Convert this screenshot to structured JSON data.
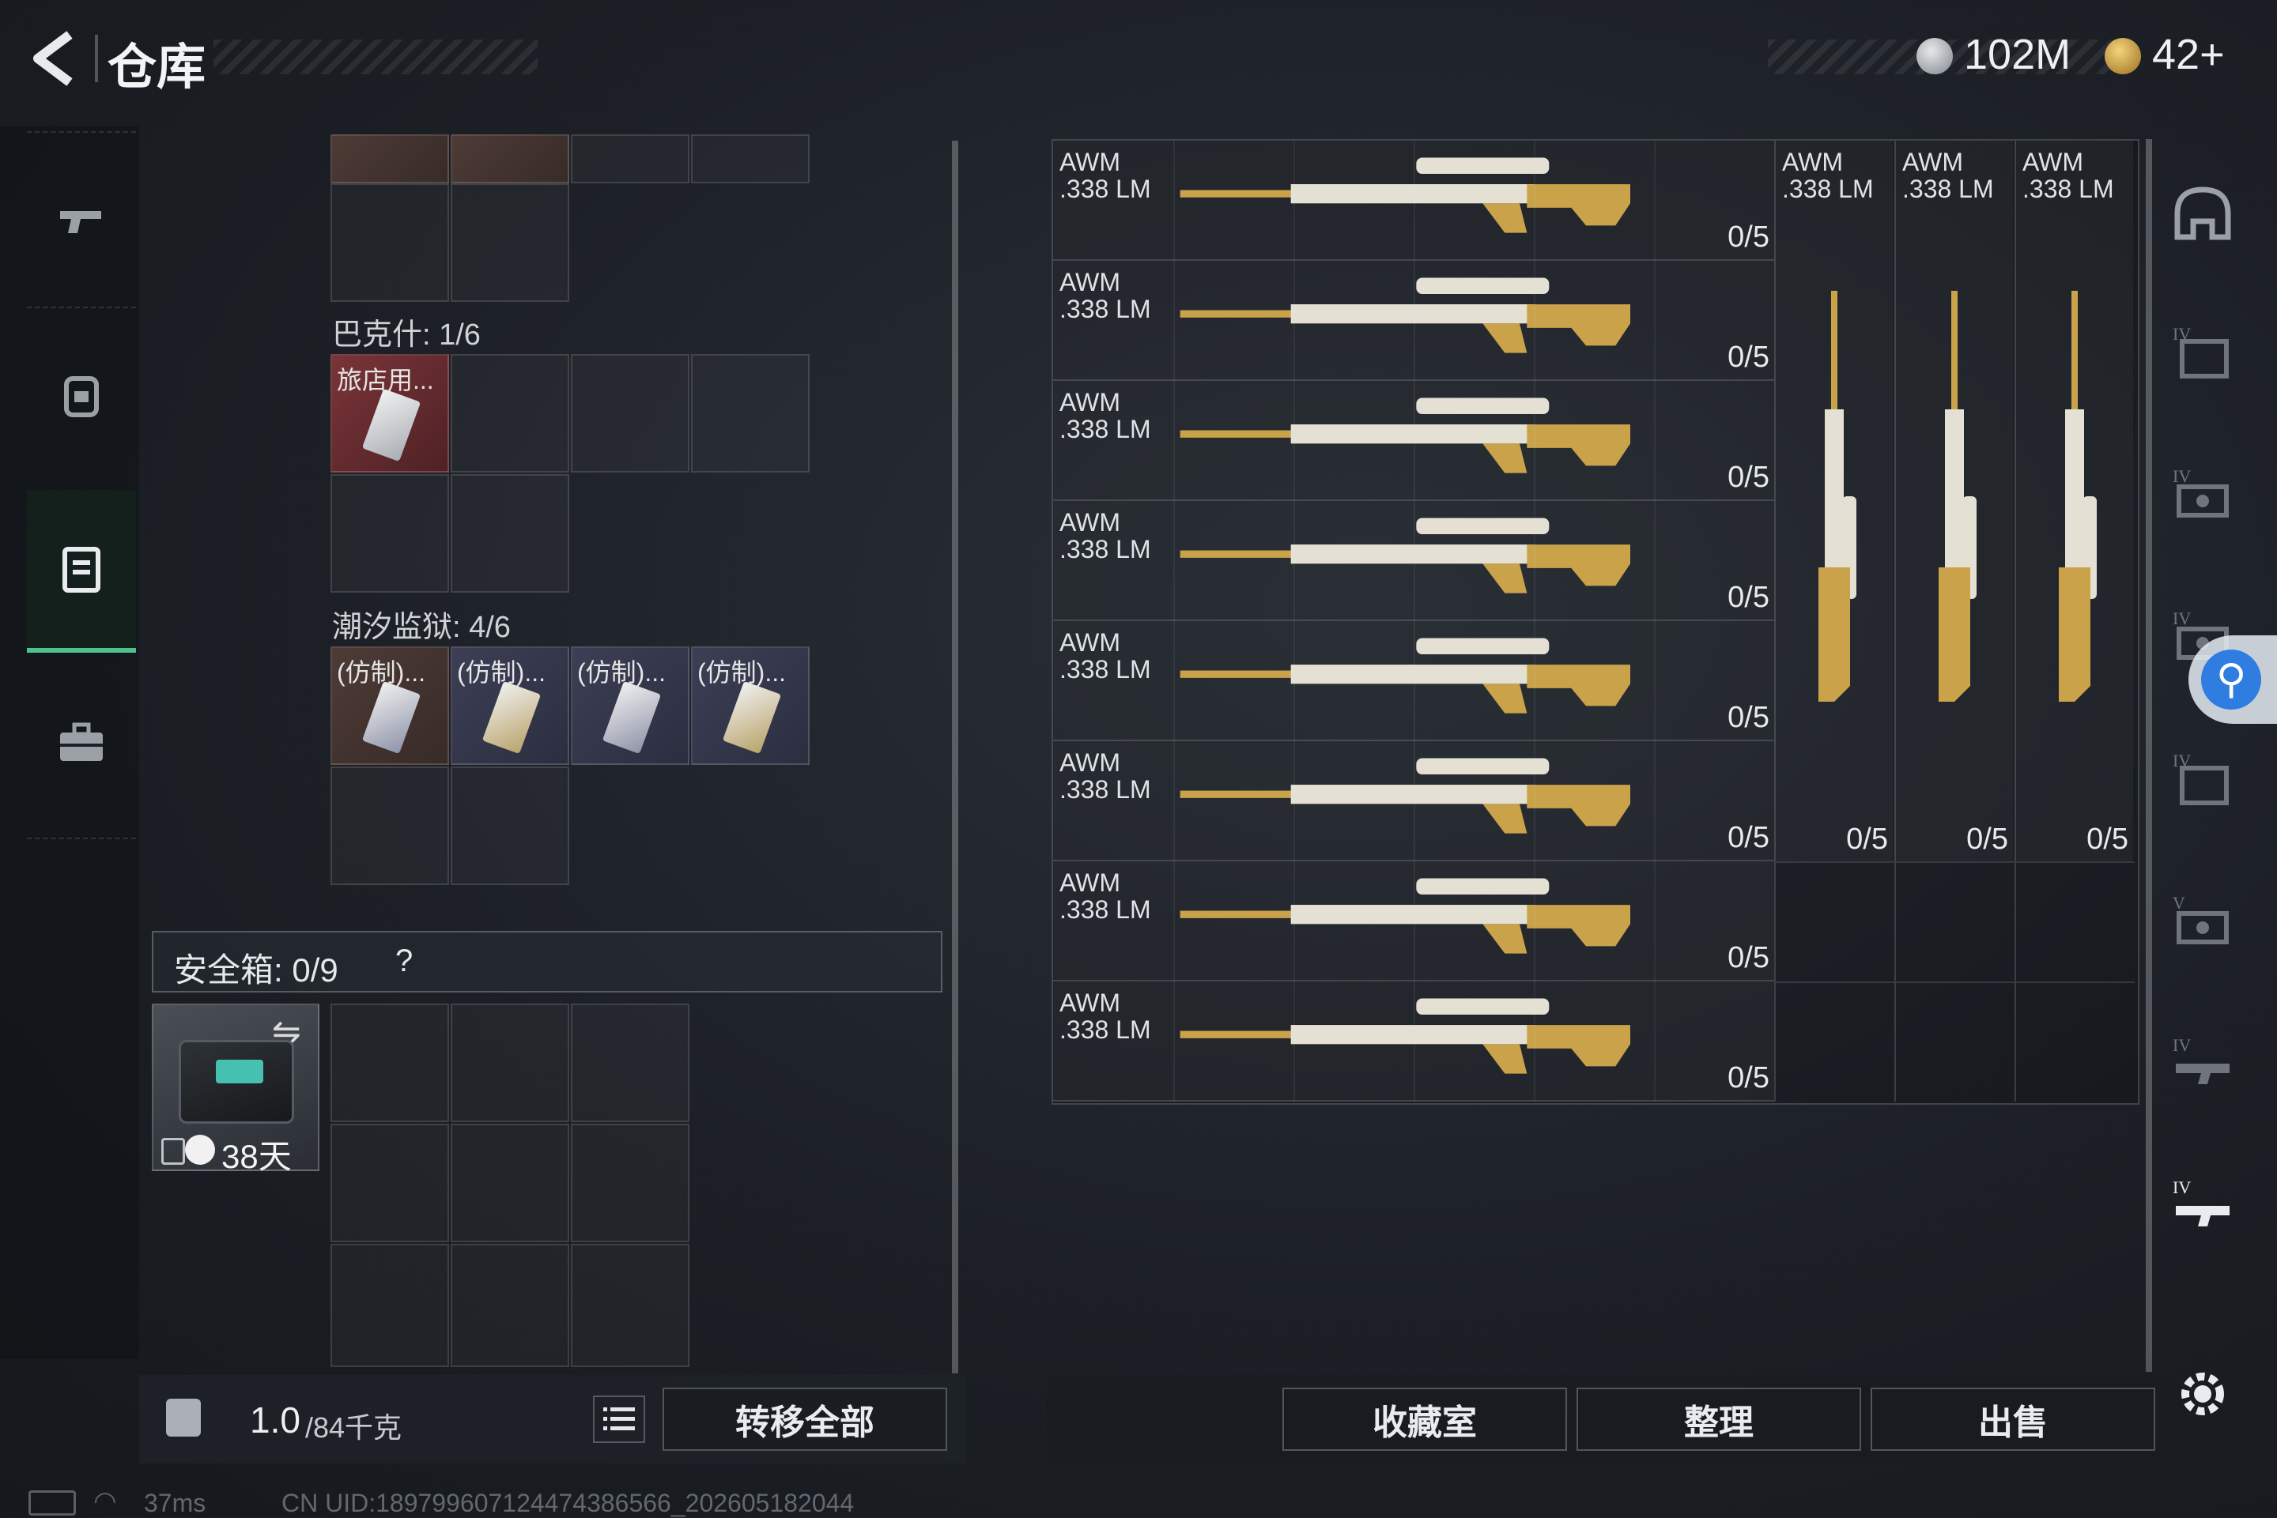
{
  "header": {
    "title": "仓库",
    "currency_silver": "102M",
    "currency_gold": "42+"
  },
  "sidebar": {
    "items": [
      {
        "icon": "pistol-icon"
      },
      {
        "icon": "backpack-icon"
      },
      {
        "icon": "vest-icon",
        "active": true
      },
      {
        "icon": "briefcase-icon"
      }
    ]
  },
  "storage": {
    "bakeshi_label": "巴克什: 1/6",
    "bakeshi_item": "旅店用...",
    "chaoxi_label": "潮汐监狱: 4/6",
    "chaoxi_items": [
      "(仿制)...",
      "(仿制)...",
      "(仿制)...",
      "(仿制)..."
    ],
    "safebox_label": "安全箱: 0/9",
    "safebox_help": "?",
    "safebox_days": "38天"
  },
  "bottom_left": {
    "weight_value": "1.0",
    "weight_capacity": "/84千克",
    "transfer_all": "转移全部"
  },
  "weapons": {
    "rows": [
      {
        "name1": "AWM",
        "name2": ".338 LM",
        "count": "0/5"
      },
      {
        "name1": "AWM",
        "name2": ".338 LM",
        "count": "0/5"
      },
      {
        "name1": "AWM",
        "name2": ".338 LM",
        "count": "0/5"
      },
      {
        "name1": "AWM",
        "name2": ".338 LM",
        "count": "0/5"
      },
      {
        "name1": "AWM",
        "name2": ".338 LM",
        "count": "0/5"
      },
      {
        "name1": "AWM",
        "name2": ".338 LM",
        "count": "0/5"
      },
      {
        "name1": "AWM",
        "name2": ".338 LM",
        "count": "0/5"
      },
      {
        "name1": "AWM",
        "name2": ".338 LM",
        "count": "0/5"
      }
    ],
    "vertical": [
      {
        "name1": "AWM",
        "name2": ".338 LM",
        "count": "0/5"
      },
      {
        "name1": "AWM",
        "name2": ".338 LM",
        "count": "0/5"
      },
      {
        "name1": "AWM",
        "name2": ".338 LM",
        "count": "0/5"
      }
    ]
  },
  "actions": {
    "collection": "收藏室",
    "organize": "整理",
    "sell": "出售"
  },
  "status": {
    "ping": "37ms",
    "uid": "CN UID:189799607124474386566_202605182044"
  },
  "colors": {
    "accent_green": "#4ec28a",
    "accessibility_blue": "#2f7de1",
    "gold": "#c9a24a"
  }
}
